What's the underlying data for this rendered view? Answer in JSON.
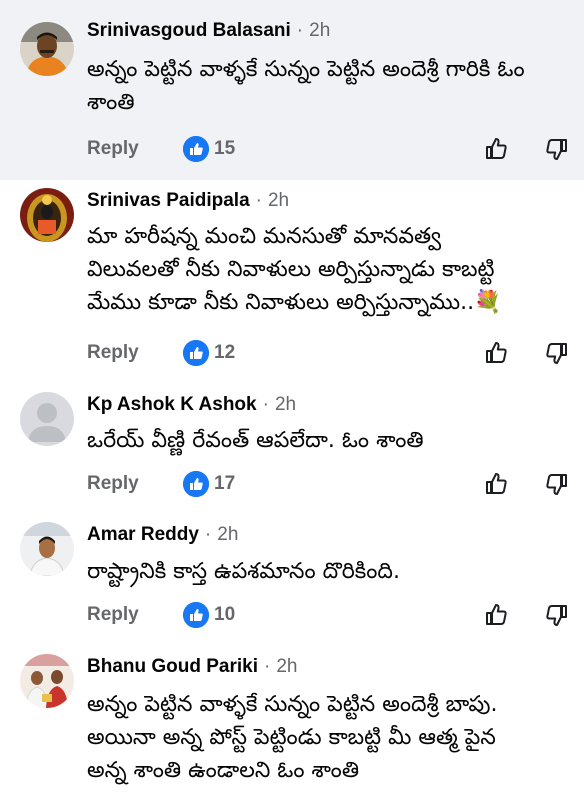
{
  "comments": [
    {
      "author": "Srinivasgoud Balasani",
      "time": "2h",
      "separator": "·",
      "text_lines": [
        "అన్నం పెట్టిన వాళ్ళకే సున్నం పెట్టిన అందెశ్రీ గారికి ఓం",
        "శాంతి"
      ],
      "reply_label": "Reply",
      "like_count": "15",
      "avatar": "man-orange-shirt-avatar"
    },
    {
      "author": "Srinivas Paidipala",
      "time": "2h",
      "separator": "·",
      "text_lines": [
        "మా హరీషన్న మంచి మనసుతో మానవత్వ",
        "విలువలతో నీకు నివాళులు అర్పిస్తున్నాడు కాబట్టి",
        "మేము కూడా నీకు నివాళులు అర్పిస్తున్నాము..💐"
      ],
      "reply_label": "Reply",
      "like_count": "12",
      "avatar": "deity-avatar"
    },
    {
      "author": "Kp Ashok K Ashok",
      "time": "2h",
      "separator": "·",
      "text_lines": [
        "ఒరేయ్ వీణ్ణి రేవంత్ ఆపలేదా. ఓం శాంతి"
      ],
      "reply_label": "Reply",
      "like_count": "17",
      "avatar": "default-avatar"
    },
    {
      "author": "Amar Reddy",
      "time": "2h",
      "separator": "·",
      "text_lines": [
        "రాష్ట్రానికి కాస్త ఉపశమానం దొరికింది."
      ],
      "reply_label": "Reply",
      "like_count": "10",
      "avatar": "man-white-shirt-avatar"
    },
    {
      "author": "Bhanu Goud Pariki",
      "time": "2h",
      "separator": "·",
      "text_lines": [
        "అన్నం పెట్టిన వాళ్ళకే సున్నం పెట్టిన అందెశ్రీ బాపు.",
        "అయినా అన్న పోస్ట్ పెట్టిండు కాబట్టి మీ ఆత్మ పైన",
        "అన్న శాంతి ఉండాలని ఓం శాంతి"
      ],
      "avatar": "group-photo-avatar"
    }
  ],
  "colors": {
    "highlight_bg": "#f0f2f5",
    "like_blue": "#1877f2",
    "secondary_text": "#65676b"
  }
}
